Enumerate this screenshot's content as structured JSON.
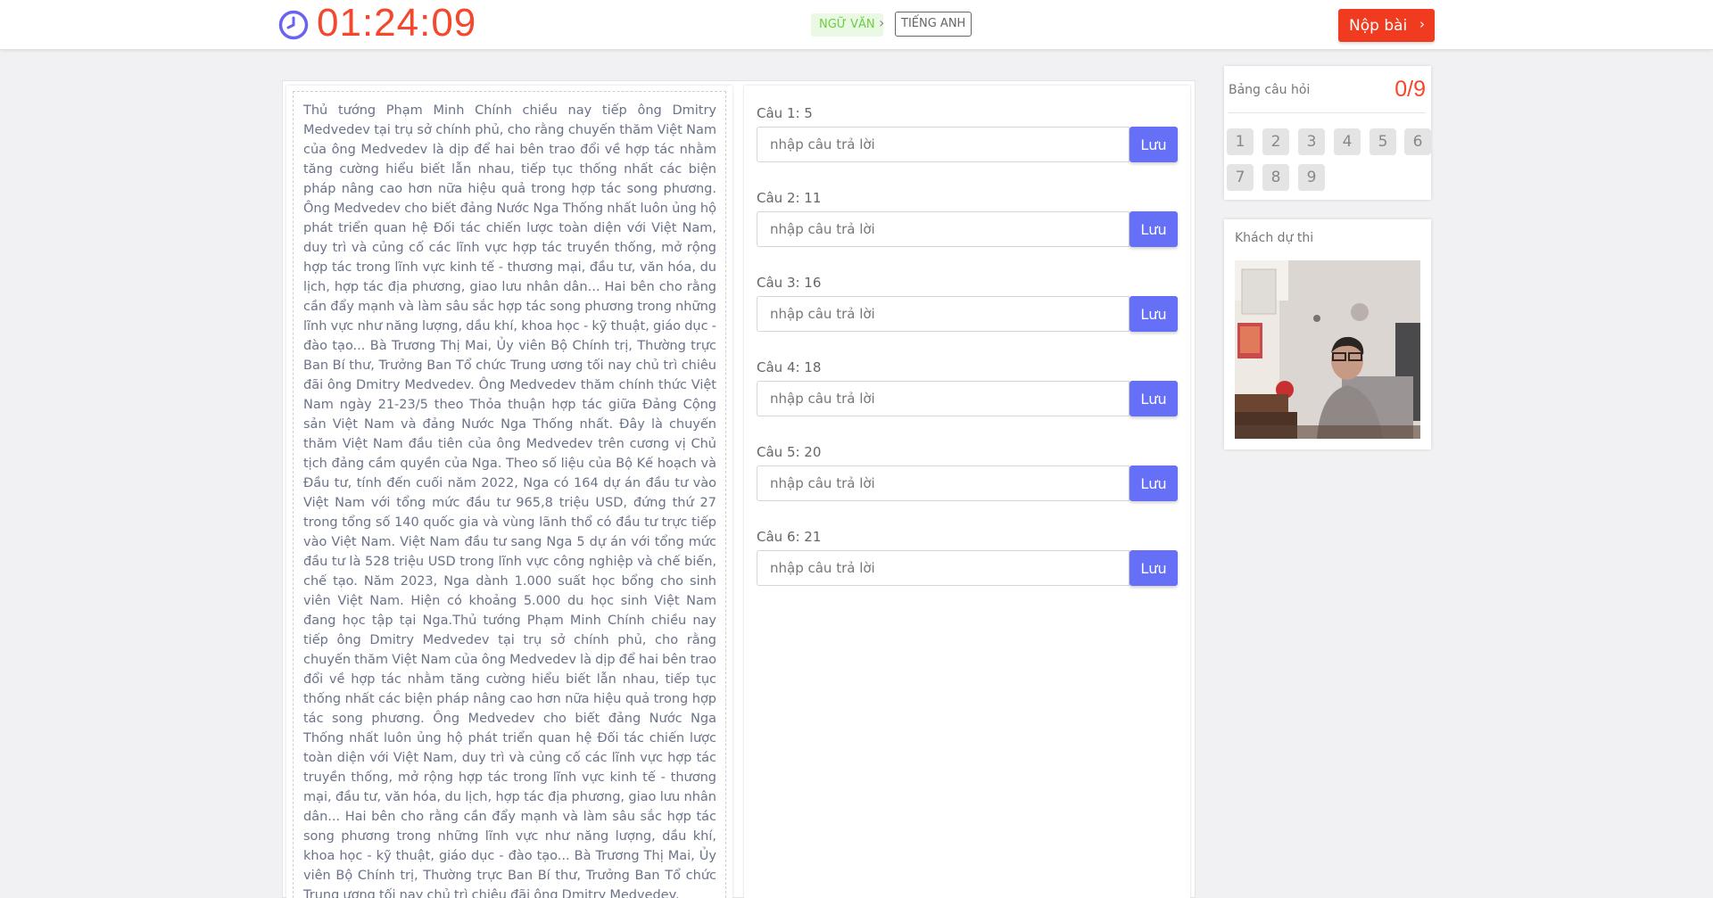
{
  "header": {
    "timer": "01:24:09",
    "subjects": [
      {
        "label": "NGỮ VĂN",
        "active": true
      },
      {
        "label": "TIẾNG ANH",
        "active": false
      }
    ],
    "submit_label": "Nộp bài"
  },
  "passage": {
    "text": "Thủ tướng Phạm Minh Chính chiều nay tiếp ông Dmitry Medvedev tại trụ sở chính phủ, cho rằng chuyến thăm Việt Nam của ông Medvedev là dịp để hai bên trao đổi về hợp tác nhằm tăng cường hiểu biết lẫn nhau, tiếp tục thống nhất các biện pháp nâng cao hơn nữa hiệu quả trong hợp tác song phương. Ông Medvedev cho biết đảng Nước Nga Thống nhất luôn ủng hộ phát triển quan hệ Đối tác chiến lược toàn diện với Việt Nam, duy trì và củng cố các lĩnh vực hợp tác truyền thống, mở rộng hợp tác trong lĩnh vực kinh tế - thương mại, đầu tư, văn hóa, du lịch, hợp tác địa phương, giao lưu nhân dân... Hai bên cho rằng cần đẩy mạnh và làm sâu sắc hợp tác song phương trong những lĩnh vực như năng lượng, dầu khí, khoa học - kỹ thuật, giáo dục - đào tạo... Bà Trương Thị Mai, Ủy viên Bộ Chính trị, Thường trực Ban Bí thư, Trưởng Ban Tổ chức Trung ương tối nay chủ trì chiêu đãi ông Dmitry Medvedev. Ông Medvedev thăm chính thức Việt Nam ngày 21-23/5 theo Thỏa thuận hợp tác giữa Đảng Cộng sản Việt Nam và đảng Nước Nga Thống nhất. Đây là chuyến thăm Việt Nam đầu tiên của ông Medvedev trên cương vị Chủ tịch đảng cầm quyền của Nga. Theo số liệu của Bộ Kế hoạch và Đầu tư, tính đến cuối năm 2022, Nga có 164 dự án đầu tư vào Việt Nam với tổng mức đầu tư 965,8 triệu USD, đứng thứ 27 trong tổng số 140 quốc gia và vùng lãnh thổ có đầu tư trực tiếp vào Việt Nam. Việt Nam đầu tư sang Nga 5 dự án với tổng mức đầu tư là 528 triệu USD trong lĩnh vực công nghiệp và chế biến, chế tạo. Năm 2023, Nga dành 1.000 suất học bổng cho sinh viên Việt Nam. Hiện có khoảng 5.000 du học sinh Việt Nam đang học tập tại Nga.Thủ tướng Phạm Minh Chính chiều nay tiếp ông Dmitry Medvedev tại trụ sở chính phủ, cho rằng chuyến thăm Việt Nam của ông Medvedev là dịp để hai bên trao đổi về hợp tác nhằm tăng cường hiểu biết lẫn nhau, tiếp tục thống nhất các biện pháp nâng cao hơn nữa hiệu quả trong hợp tác song phương. Ông Medvedev cho biết đảng Nước Nga Thống nhất luôn ủng hộ phát triển quan hệ Đối tác chiến lược toàn diện với Việt Nam, duy trì và củng cố các lĩnh vực hợp tác truyền thống, mở rộng hợp tác trong lĩnh vực kinh tế - thương mại, đầu tư, văn hóa, du lịch, hợp tác địa phương, giao lưu nhân dân... Hai bên cho rằng cần đẩy mạnh và làm sâu sắc hợp tác song phương trong những lĩnh vực như năng lượng, dầu khí, khoa học - kỹ thuật, giáo dục - đào tạo... Bà Trương Thị Mai, Ủy viên Bộ Chính trị, Thường trực Ban Bí thư, Trưởng Ban Tổ chức Trung ương tối nay chủ trì chiêu đãi ông Dmitry Medvedev."
  },
  "questions": [
    {
      "title": "Câu 1:  5",
      "placeholder": "nhập câu trả lời",
      "save_label": "Lưu"
    },
    {
      "title": "Câu 2:  11",
      "placeholder": "nhập câu trả lời",
      "save_label": "Lưu"
    },
    {
      "title": "Câu 3:  16",
      "placeholder": "nhập câu trả lời",
      "save_label": "Lưu"
    },
    {
      "title": "Câu 4:  18",
      "placeholder": "nhập câu trả lời",
      "save_label": "Lưu"
    },
    {
      "title": "Câu 5:  20",
      "placeholder": "nhập câu trả lời",
      "save_label": "Lưu"
    },
    {
      "title": "Câu 6:  21",
      "placeholder": "nhập câu trả lời",
      "save_label": "Lưu"
    }
  ],
  "question_board": {
    "title": "Bảng câu hỏi",
    "count": "0/9",
    "numbers": [
      "1",
      "2",
      "3",
      "4",
      "5",
      "6",
      "7",
      "8",
      "9"
    ]
  },
  "candidate": {
    "title": "Khách dự thi"
  },
  "colors": {
    "accent_red": "#f4472c",
    "submit_red": "#f13b21",
    "save_blue": "#6570f7",
    "active_subject_green": "#6ccd45",
    "clock_purple": "#6a63f0"
  },
  "icons": {
    "timer": "clock-icon",
    "subject_separator": "chevron-right-icon",
    "submit": "chevron-right-icon"
  }
}
